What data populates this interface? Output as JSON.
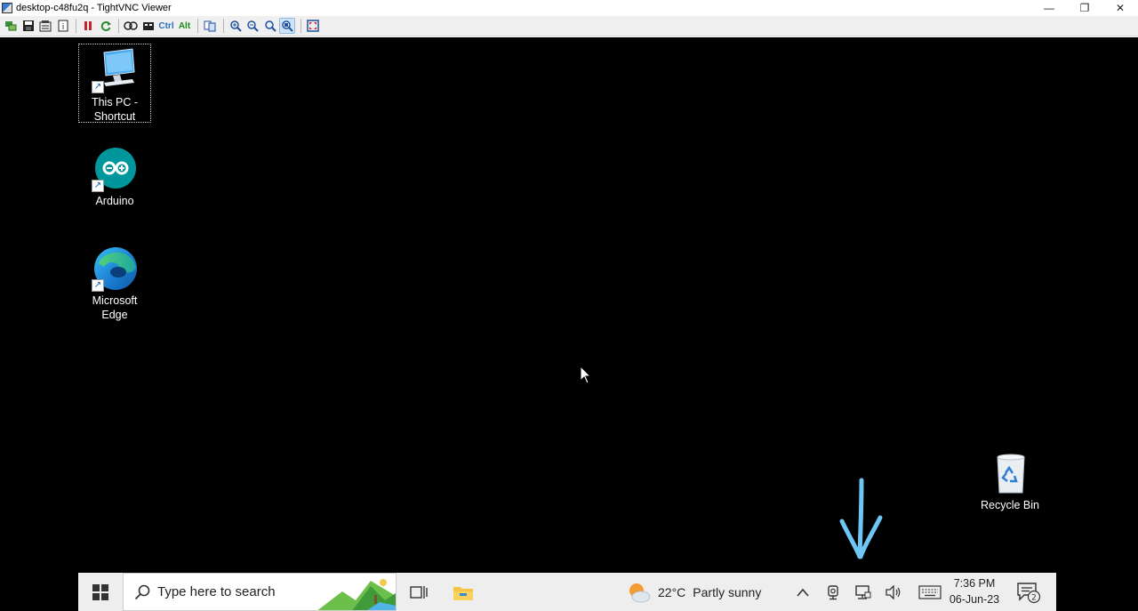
{
  "window": {
    "title": "desktop-c48fu2q - TightVNC Viewer",
    "controls": {
      "minimize": "—",
      "restore": "❐",
      "close": "✕"
    }
  },
  "toolbar": {
    "ctrl_label": "Ctrl",
    "alt_label": "Alt",
    "buttons": [
      "new-connection-icon",
      "save-icon",
      "options-icon",
      "info-icon",
      "pause-icon",
      "refresh-icon",
      "ctrl-alt-del-icon",
      "ctrl-esc-icon",
      "transfer-icon",
      "zoom-in-icon",
      "zoom-out-icon",
      "zoom-100-icon",
      "zoom-fit-icon",
      "fullscreen-icon"
    ]
  },
  "desktop": {
    "icons": {
      "this_pc": {
        "label_line1": "This PC -",
        "label_line2": "Shortcut"
      },
      "arduino": {
        "label": "Arduino"
      },
      "edge": {
        "label_line1": "Microsoft",
        "label_line2": "Edge"
      },
      "recycle_bin": {
        "label": "Recycle Bin"
      }
    },
    "annotation_color": "#6ec6f5"
  },
  "taskbar": {
    "search_placeholder": "Type here to search",
    "weather": {
      "temp": "22°C",
      "condition": "Partly sunny"
    },
    "clock": {
      "time": "7:36 PM",
      "date": "06-Jun-23"
    },
    "notification_count": "2"
  }
}
